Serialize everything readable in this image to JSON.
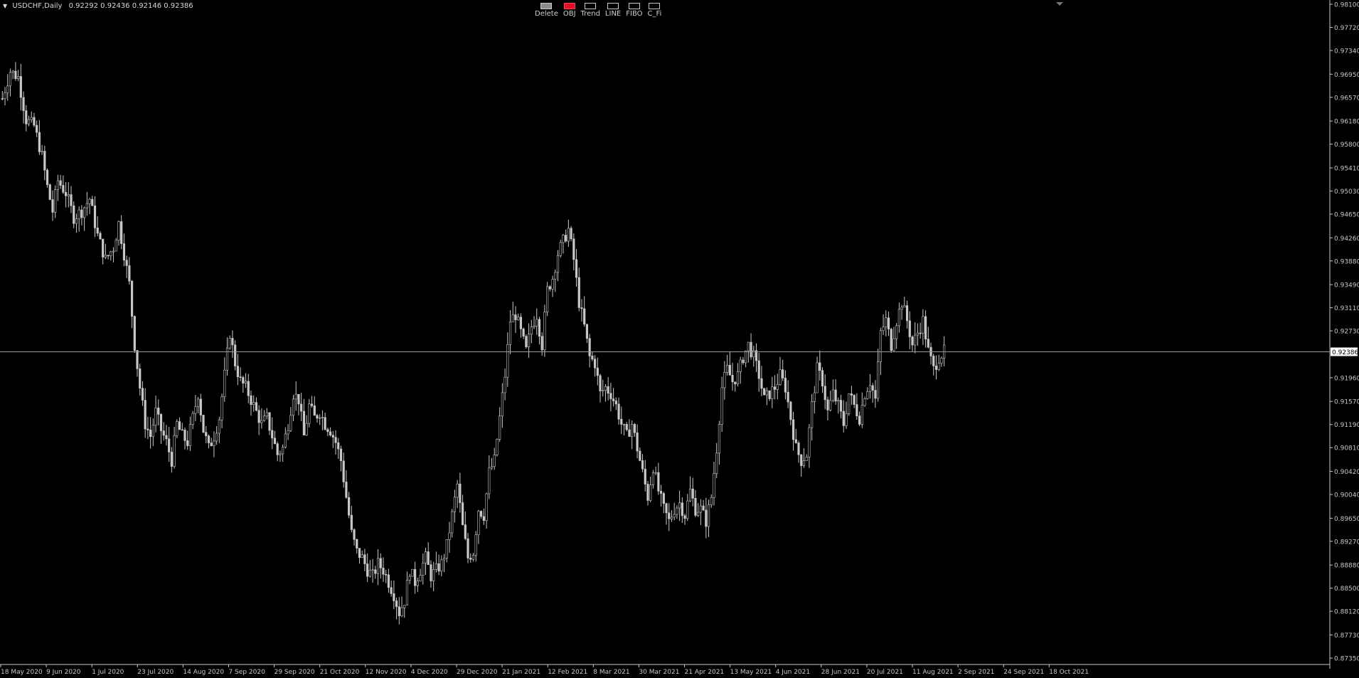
{
  "header": {
    "symbol": "USDCHF,Daily",
    "ohlc": "0.92292 0.92436 0.92146 0.92386"
  },
  "toolbar": [
    {
      "label": "Delete",
      "style": "filled"
    },
    {
      "label": "OBJ",
      "style": "red"
    },
    {
      "label": "Trend",
      "style": "outline"
    },
    {
      "label": "LINE",
      "style": "outline"
    },
    {
      "label": "FIBO",
      "style": "outline"
    },
    {
      "label": "C_Fi",
      "style": "outline"
    }
  ],
  "colors": {
    "background": "#000000",
    "candles": "#c8c8c8",
    "axis": "#c8c8c8",
    "bid_line": "#9a9a9a",
    "price_label_bg": "#ffffff"
  },
  "chart_data": {
    "type": "candlestick",
    "current_price": "0.92386",
    "y_ticks": [
      "0.98100",
      "0.97720",
      "0.97340",
      "0.96950",
      "0.96570",
      "0.96180",
      "0.95800",
      "0.95410",
      "0.95030",
      "0.94650",
      "0.94260",
      "0.93880",
      "0.93490",
      "0.93110",
      "0.92730",
      "0.91960",
      "0.91570",
      "0.91190",
      "0.90810",
      "0.90420",
      "0.90040",
      "0.89650",
      "0.89270",
      "0.88880",
      "0.88500",
      "0.88120",
      "0.87730",
      "0.87350"
    ],
    "ylim": [
      0.8735,
      0.981
    ],
    "x_ticks": [
      "18 May 2020",
      "9 Jun 2020",
      "1 Jul 2020",
      "23 Jul 2020",
      "14 Aug 2020",
      "7 Sep 2020",
      "29 Sep 2020",
      "21 Oct 2020",
      "12 Nov 2020",
      "4 Dec 2020",
      "29 Dec 2020",
      "21 Jan 2021",
      "12 Feb 2021",
      "8 Mar 2021",
      "30 Mar 2021",
      "21 Apr 2021",
      "13 May 2021",
      "4 Jun 2021",
      "28 Jun 2021",
      "20 Jul 2021",
      "11 Aug 2021",
      "2 Sep 2021",
      "24 Sep 2021",
      "18 Oct 2021"
    ],
    "close_path": [
      [
        0,
        0.9655
      ],
      [
        3,
        0.97
      ],
      [
        6,
        0.969
      ],
      [
        9,
        0.962
      ],
      [
        12,
        0.961
      ],
      [
        15,
        0.956
      ],
      [
        17,
        0.951
      ],
      [
        19,
        0.947
      ],
      [
        21,
        0.952
      ],
      [
        24,
        0.95
      ],
      [
        27,
        0.946
      ],
      [
        30,
        0.947
      ],
      [
        33,
        0.949
      ],
      [
        36,
        0.943
      ],
      [
        39,
        0.939
      ],
      [
        42,
        0.941
      ],
      [
        44,
        0.945
      ],
      [
        46,
        0.94
      ],
      [
        48,
        0.935
      ],
      [
        50,
        0.925
      ],
      [
        52,
        0.918
      ],
      [
        54,
        0.912
      ],
      [
        56,
        0.91
      ],
      [
        58,
        0.914
      ],
      [
        60,
        0.911
      ],
      [
        62,
        0.909
      ],
      [
        64,
        0.906
      ],
      [
        66,
        0.912
      ],
      [
        68,
        0.91
      ],
      [
        70,
        0.909
      ],
      [
        72,
        0.913
      ],
      [
        74,
        0.917
      ],
      [
        76,
        0.911
      ],
      [
        78,
        0.908
      ],
      [
        80,
        0.91
      ],
      [
        82,
        0.913
      ],
      [
        84,
        0.92
      ],
      [
        86,
        0.927
      ],
      [
        88,
        0.922
      ],
      [
        90,
        0.919
      ],
      [
        92,
        0.918
      ],
      [
        94,
        0.916
      ],
      [
        96,
        0.914
      ],
      [
        98,
        0.912
      ],
      [
        100,
        0.913
      ],
      [
        102,
        0.91
      ],
      [
        104,
        0.907
      ],
      [
        106,
        0.908
      ],
      [
        108,
        0.912
      ],
      [
        110,
        0.917
      ],
      [
        112,
        0.916
      ],
      [
        114,
        0.91
      ],
      [
        116,
        0.915
      ],
      [
        118,
        0.913
      ],
      [
        120,
        0.914
      ],
      [
        122,
        0.912
      ],
      [
        124,
        0.911
      ],
      [
        126,
        0.909
      ],
      [
        128,
        0.906
      ],
      [
        130,
        0.9
      ],
      [
        132,
        0.894
      ],
      [
        134,
        0.891
      ],
      [
        136,
        0.89
      ],
      [
        138,
        0.888
      ],
      [
        140,
        0.887
      ],
      [
        142,
        0.889
      ],
      [
        144,
        0.888
      ],
      [
        146,
        0.886
      ],
      [
        148,
        0.884
      ],
      [
        150,
        0.881
      ],
      [
        152,
        0.883
      ],
      [
        154,
        0.888
      ],
      [
        156,
        0.886
      ],
      [
        158,
        0.888
      ],
      [
        160,
        0.89
      ],
      [
        162,
        0.887
      ],
      [
        164,
        0.888
      ],
      [
        166,
        0.889
      ],
      [
        168,
        0.892
      ],
      [
        170,
        0.897
      ],
      [
        172,
        0.902
      ],
      [
        174,
        0.895
      ],
      [
        176,
        0.89
      ],
      [
        178,
        0.891
      ],
      [
        180,
        0.898
      ],
      [
        182,
        0.897
      ],
      [
        184,
        0.904
      ],
      [
        186,
        0.906
      ],
      [
        188,
        0.913
      ],
      [
        190,
        0.92
      ],
      [
        192,
        0.929
      ],
      [
        194,
        0.93
      ],
      [
        196,
        0.927
      ],
      [
        198,
        0.924
      ],
      [
        200,
        0.928
      ],
      [
        202,
        0.93
      ],
      [
        204,
        0.925
      ],
      [
        206,
        0.934
      ],
      [
        208,
        0.936
      ],
      [
        210,
        0.94
      ],
      [
        212,
        0.942
      ],
      [
        214,
        0.944
      ],
      [
        216,
        0.939
      ],
      [
        218,
        0.932
      ],
      [
        220,
        0.928
      ],
      [
        222,
        0.923
      ],
      [
        224,
        0.922
      ],
      [
        226,
        0.917
      ],
      [
        228,
        0.918
      ],
      [
        230,
        0.917
      ],
      [
        232,
        0.915
      ],
      [
        234,
        0.912
      ],
      [
        236,
        0.91
      ],
      [
        238,
        0.912
      ],
      [
        240,
        0.908
      ],
      [
        242,
        0.904
      ],
      [
        244,
        0.9
      ],
      [
        246,
        0.905
      ],
      [
        248,
        0.901
      ],
      [
        250,
        0.898
      ],
      [
        252,
        0.896
      ],
      [
        254,
        0.898
      ],
      [
        256,
        0.899
      ],
      [
        258,
        0.897
      ],
      [
        260,
        0.901
      ],
      [
        262,
        0.898
      ],
      [
        264,
        0.898
      ],
      [
        266,
        0.896
      ],
      [
        268,
        0.9
      ],
      [
        270,
        0.908
      ],
      [
        272,
        0.918
      ],
      [
        274,
        0.921
      ],
      [
        276,
        0.919
      ],
      [
        278,
        0.92
      ],
      [
        280,
        0.923
      ],
      [
        282,
        0.925
      ],
      [
        284,
        0.923
      ],
      [
        286,
        0.92
      ],
      [
        288,
        0.916
      ],
      [
        290,
        0.917
      ],
      [
        292,
        0.918
      ],
      [
        294,
        0.92
      ],
      [
        296,
        0.918
      ],
      [
        298,
        0.913
      ],
      [
        300,
        0.908
      ],
      [
        302,
        0.906
      ],
      [
        304,
        0.907
      ],
      [
        306,
        0.915
      ],
      [
        308,
        0.921
      ],
      [
        310,
        0.919
      ],
      [
        312,
        0.914
      ],
      [
        314,
        0.917
      ],
      [
        316,
        0.915
      ],
      [
        318,
        0.912
      ],
      [
        320,
        0.917
      ],
      [
        322,
        0.915
      ],
      [
        324,
        0.913
      ],
      [
        326,
        0.917
      ],
      [
        328,
        0.919
      ],
      [
        330,
        0.916
      ],
      [
        332,
        0.927
      ],
      [
        334,
        0.929
      ],
      [
        336,
        0.925
      ],
      [
        338,
        0.929
      ],
      [
        340,
        0.932
      ],
      [
        342,
        0.929
      ],
      [
        344,
        0.925
      ],
      [
        346,
        0.927
      ],
      [
        348,
        0.929
      ],
      [
        350,
        0.924
      ],
      [
        352,
        0.921
      ],
      [
        354,
        0.923
      ],
      [
        356,
        0.9239
      ]
    ]
  }
}
